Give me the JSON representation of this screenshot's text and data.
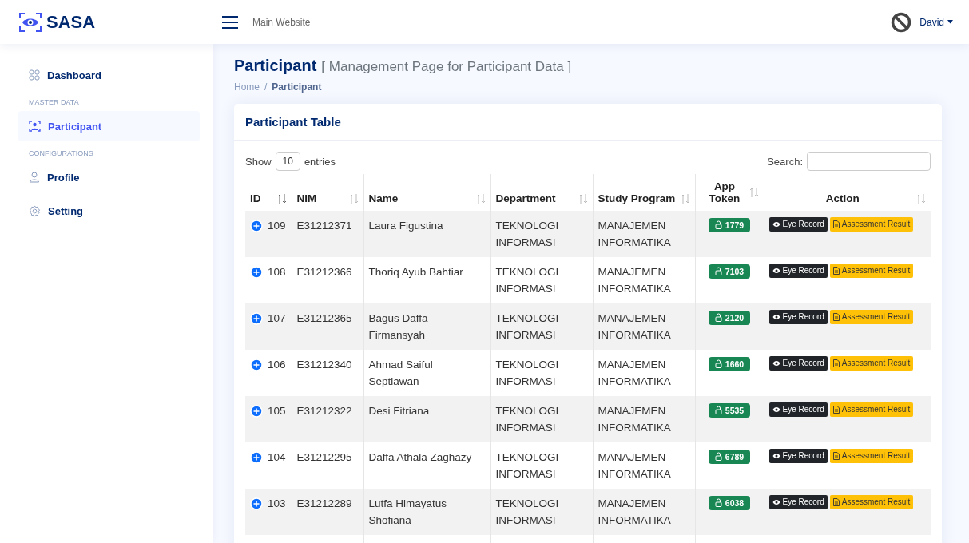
{
  "brand": "SASA",
  "topbar": {
    "link": "Main Website",
    "user": "David"
  },
  "sidebar": {
    "items": [
      {
        "kind": "item",
        "label": "Dashboard",
        "selected": false
      },
      {
        "kind": "heading",
        "label": "MASTER DATA"
      },
      {
        "kind": "item",
        "label": "Participant",
        "selected": true
      },
      {
        "kind": "heading",
        "label": "CONFIGURATIONS"
      },
      {
        "kind": "item",
        "label": "Profile",
        "selected": false
      },
      {
        "kind": "item",
        "label": "Setting",
        "selected": false
      }
    ]
  },
  "page": {
    "title": "Participant",
    "subtitle": "[ Management Page for Participant Data ]",
    "breadcrumb_separator": "/",
    "breadcrumb": [
      {
        "label": "Home",
        "selected": false
      },
      {
        "label": "Participant",
        "selected": true
      }
    ]
  },
  "card": {
    "title": "Participant Table",
    "length": {
      "before": "Show",
      "value": "10",
      "after": "entries"
    },
    "search_label": "Search:"
  },
  "table": {
    "columns": [
      "ID",
      "NIM",
      "Name",
      "Department",
      "Study Program",
      "App Token",
      "Action"
    ],
    "rows": [
      {
        "id": "109",
        "nim": "E31212371",
        "name": "Laura Figustina",
        "department": "TEKNOLOGI INFORMASI",
        "program": "MANAJEMEN INFORMATIKA",
        "token": "1779",
        "actions": [
          "Eye Record",
          "Assessment Result"
        ]
      },
      {
        "id": "108",
        "nim": "E31212366",
        "name": "Thoriq Ayub Bahtiar",
        "department": "TEKNOLOGI INFORMASI",
        "program": "MANAJEMEN INFORMATIKA",
        "token": "7103",
        "actions": [
          "Eye Record",
          "Assessment Result"
        ]
      },
      {
        "id": "107",
        "nim": "E31212365",
        "name": "Bagus Daffa Firmansyah",
        "department": "TEKNOLOGI INFORMASI",
        "program": "MANAJEMEN INFORMATIKA",
        "token": "2120",
        "actions": [
          "Eye Record",
          "Assessment Result"
        ]
      },
      {
        "id": "106",
        "nim": "E31212340",
        "name": "Ahmad Saiful Septiawan",
        "department": "TEKNOLOGI INFORMASI",
        "program": "MANAJEMEN INFORMATIKA",
        "token": "1660",
        "actions": [
          "Eye Record",
          "Assessment Result"
        ]
      },
      {
        "id": "105",
        "nim": "E31212322",
        "name": "Desi Fitriana",
        "department": "TEKNOLOGI INFORMASI",
        "program": "MANAJEMEN INFORMATIKA",
        "token": "5535",
        "actions": [
          "Eye Record",
          "Assessment Result"
        ]
      },
      {
        "id": "104",
        "nim": "E31212295",
        "name": "Daffa Athala Zaghazy",
        "department": "TEKNOLOGI INFORMASI",
        "program": "MANAJEMEN INFORMATIKA",
        "token": "6789",
        "actions": [
          "Eye Record",
          "Assessment Result"
        ]
      },
      {
        "id": "103",
        "nim": "E31212289",
        "name": "Lutfa Himayatus Shofiana",
        "department": "TEKNOLOGI INFORMASI",
        "program": "MANAJEMEN INFORMATIKA",
        "token": "6038",
        "actions": [
          "Eye Record",
          "Assessment Result"
        ]
      }
    ]
  }
}
